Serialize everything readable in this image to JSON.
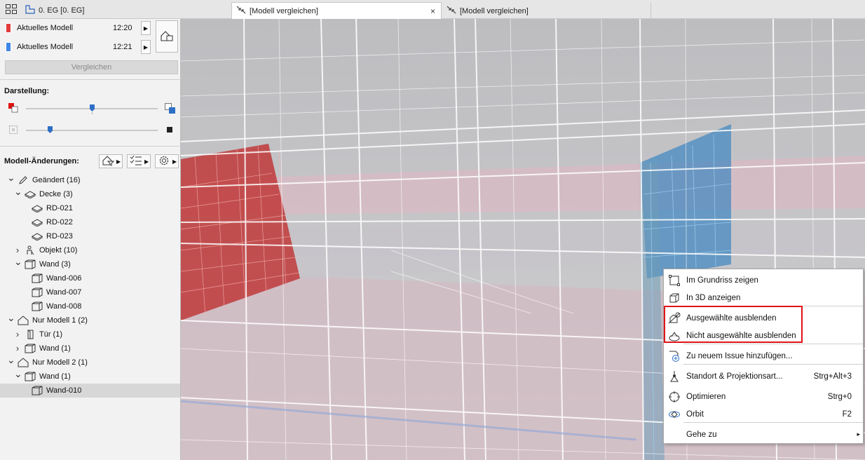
{
  "tabs": {
    "layer_label": "0. EG [0. EG]",
    "tab1_label": "[Modell vergleichen]",
    "tab2_label": "[Modell vergleichen]",
    "close_glyph": "×"
  },
  "panel": {
    "models": [
      {
        "label": "Aktuelles Modell",
        "time": "12:20",
        "color": "#e33b3b"
      },
      {
        "label": "Aktuelles Modell",
        "time": "12:21",
        "color": "#3f86e8"
      }
    ],
    "compare_button": "Vergleichen",
    "display_heading": "Darstellung:",
    "changes_heading": "Modell-Änderungen:",
    "slider1_value": 0.5,
    "slider2_value": 0.18
  },
  "tree": [
    {
      "label": "Geändert (16)",
      "level": 0,
      "toggle": "v",
      "icon": "pencil-icon"
    },
    {
      "label": "Decke (3)",
      "level": 1,
      "toggle": "v",
      "icon": "slab-icon"
    },
    {
      "label": "RD-021",
      "level": 2,
      "toggle": "",
      "icon": "slab-icon"
    },
    {
      "label": "RD-022",
      "level": 2,
      "toggle": "",
      "icon": "slab-icon"
    },
    {
      "label": "RD-023",
      "level": 2,
      "toggle": "",
      "icon": "slab-icon"
    },
    {
      "label": "Objekt (10)",
      "level": 1,
      "toggle": ">",
      "icon": "object-icon"
    },
    {
      "label": "Wand (3)",
      "level": 1,
      "toggle": "v",
      "icon": "wall-icon"
    },
    {
      "label": "Wand-006",
      "level": 2,
      "toggle": "",
      "icon": "wall-icon"
    },
    {
      "label": "Wand-007",
      "level": 2,
      "toggle": "",
      "icon": "wall-icon"
    },
    {
      "label": "Wand-008",
      "level": 2,
      "toggle": "",
      "icon": "wall-icon"
    },
    {
      "label": "Nur Modell 1 (2)",
      "level": 0,
      "toggle": "v",
      "icon": "house-icon"
    },
    {
      "label": "Tür (1)",
      "level": 1,
      "toggle": ">",
      "icon": "door-icon"
    },
    {
      "label": "Wand (1)",
      "level": 1,
      "toggle": ">",
      "icon": "wall-icon"
    },
    {
      "label": "Nur Modell 2 (1)",
      "level": 0,
      "toggle": "v",
      "icon": "house-icon"
    },
    {
      "label": "Wand (1)",
      "level": 1,
      "toggle": "v",
      "icon": "wall-icon"
    },
    {
      "label": "Wand-010",
      "level": 2,
      "toggle": "",
      "icon": "wall-icon",
      "selected": true
    }
  ],
  "menu": {
    "items": [
      {
        "label": "Im Grundriss zeigen",
        "shortcut": "",
        "icon": "floorplan-icon"
      },
      {
        "label": "In 3D anzeigen",
        "shortcut": "",
        "icon": "3d-cube-icon"
      },
      {
        "label": "Ausgewählte ausblenden",
        "shortcut": "",
        "icon": "hide-selected-icon"
      },
      {
        "label": "Nicht ausgewählte ausblenden",
        "shortcut": "",
        "icon": "hide-unselected-icon"
      },
      {
        "label": "Zu neuem Issue hinzufügen...",
        "shortcut": "",
        "icon": "issue-add-icon"
      },
      {
        "label": "Standort & Projektionsart...",
        "shortcut": "Strg+Alt+3",
        "icon": "camera-position-icon"
      },
      {
        "label": "Optimieren",
        "shortcut": "Strg+0",
        "icon": "zoom-fit-icon"
      },
      {
        "label": "Orbit",
        "shortcut": "F2",
        "icon": "orbit-icon"
      },
      {
        "label": "Gehe zu",
        "shortcut": "▸",
        "icon": ""
      }
    ],
    "highlight_color": "#e0141a"
  }
}
